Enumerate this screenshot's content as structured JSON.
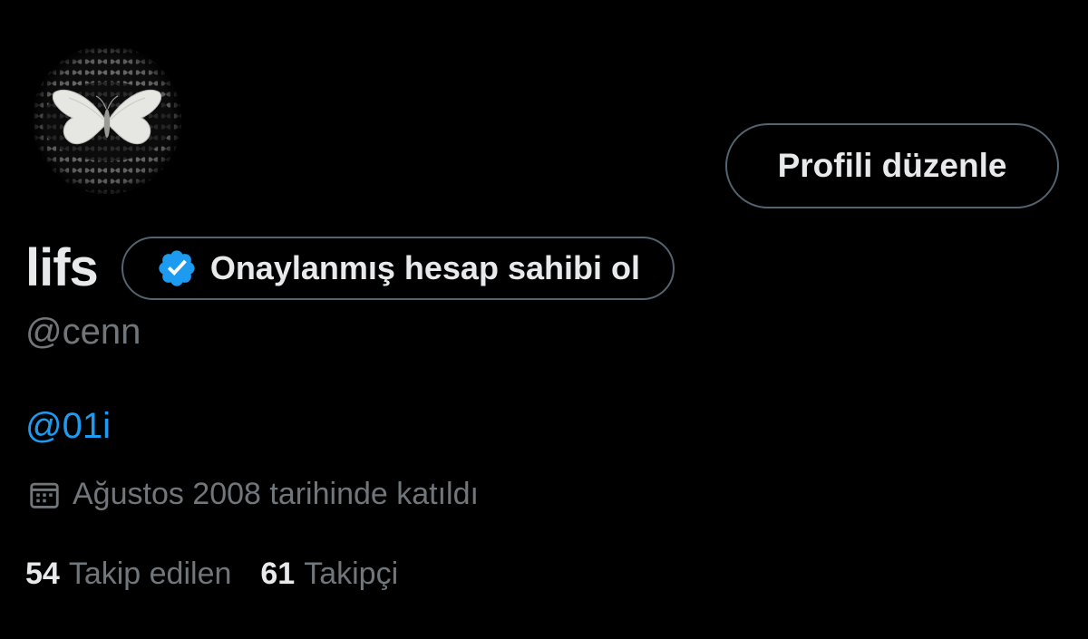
{
  "profile": {
    "display_name": "lifs",
    "handle": "@cenn",
    "bio_link": "@01i",
    "joined_text": "Ağustos 2008 tarihinde katıldı"
  },
  "actions": {
    "edit_profile_label": "Profili düzenle",
    "verify_label": "Onaylanmış hesap sahibi ol"
  },
  "stats": {
    "following_count": "54",
    "following_label": "Takip edilen",
    "followers_count": "61",
    "followers_label": "Takipçi"
  },
  "icons": {
    "verified": "verified-badge-icon",
    "calendar": "calendar-icon",
    "avatar": "butterfly-avatar"
  },
  "colors": {
    "background": "#000000",
    "primary_text": "#e7e9ea",
    "secondary_text": "#71767b",
    "link": "#1d9bf0",
    "border": "#536471",
    "verified_blue": "#1d9bf0"
  }
}
